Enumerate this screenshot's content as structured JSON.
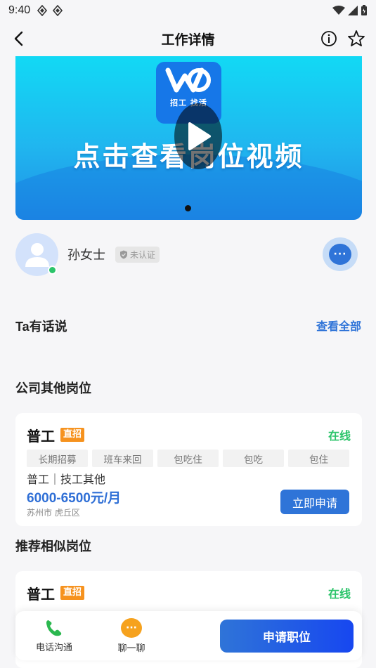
{
  "status_bar": {
    "time": "9:40"
  },
  "nav": {
    "title": "工作详情"
  },
  "banner": {
    "logo_sub": "招工 找活",
    "text": "点击查看岗位视频"
  },
  "recruiter": {
    "name": "孙女士",
    "verify_badge": "未认证"
  },
  "ta_says": {
    "title": "Ta有话说",
    "see_all": "查看全部"
  },
  "company_jobs": {
    "title": "公司其他岗位",
    "job": {
      "title": "普工",
      "tag_direct": "直招",
      "status": "在线",
      "tags": [
        "长期招募",
        "班车来回",
        "包吃住",
        "包吃",
        "包住"
      ],
      "category": "普工｜技工其他",
      "salary": "6000-6500元/月",
      "location": "苏州市 虎丘区",
      "apply_label": "立即申请"
    }
  },
  "similar_jobs": {
    "title": "推荐相似岗位",
    "job": {
      "title": "普工",
      "tag_direct": "直招",
      "status": "在线"
    }
  },
  "bottom_bar": {
    "phone_label": "电话沟通",
    "chat_label": "聊一聊",
    "apply_label": "申请职位"
  },
  "colors": {
    "accent": "#2f74d8",
    "online": "#2bc46a",
    "direct_tag": "#f6921e"
  }
}
